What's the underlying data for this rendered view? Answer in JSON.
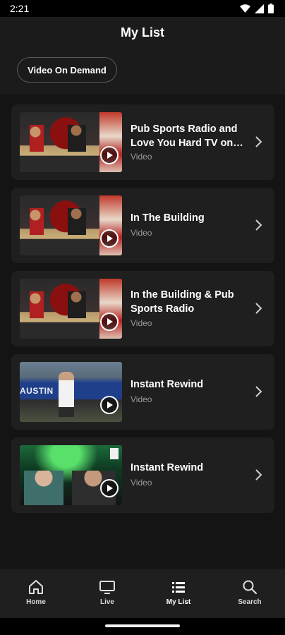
{
  "status_bar": {
    "time": "2:21"
  },
  "header": {
    "title": "My List",
    "filter": "Video On Demand"
  },
  "items": [
    {
      "title": "Pub Sports Radio and Love You Hard TV on…",
      "type": "Video",
      "thumbnail": "studio-show"
    },
    {
      "title": "In The Building",
      "type": "Video",
      "thumbnail": "studio-show"
    },
    {
      "title": "In the Building & Pub Sports Radio",
      "type": "Video",
      "thumbnail": "studio-show"
    },
    {
      "title": "Instant Rewind",
      "type": "Video",
      "thumbnail": "baseball-game"
    },
    {
      "title": "Instant Rewind",
      "type": "Video",
      "thumbnail": "neon-podcast"
    }
  ],
  "bottom_nav": [
    {
      "label": "Home",
      "icon": "home-icon"
    },
    {
      "label": "Live",
      "icon": "tv-icon"
    },
    {
      "label": "My List",
      "icon": "list-icon",
      "active": true
    },
    {
      "label": "Search",
      "icon": "search-icon"
    }
  ]
}
